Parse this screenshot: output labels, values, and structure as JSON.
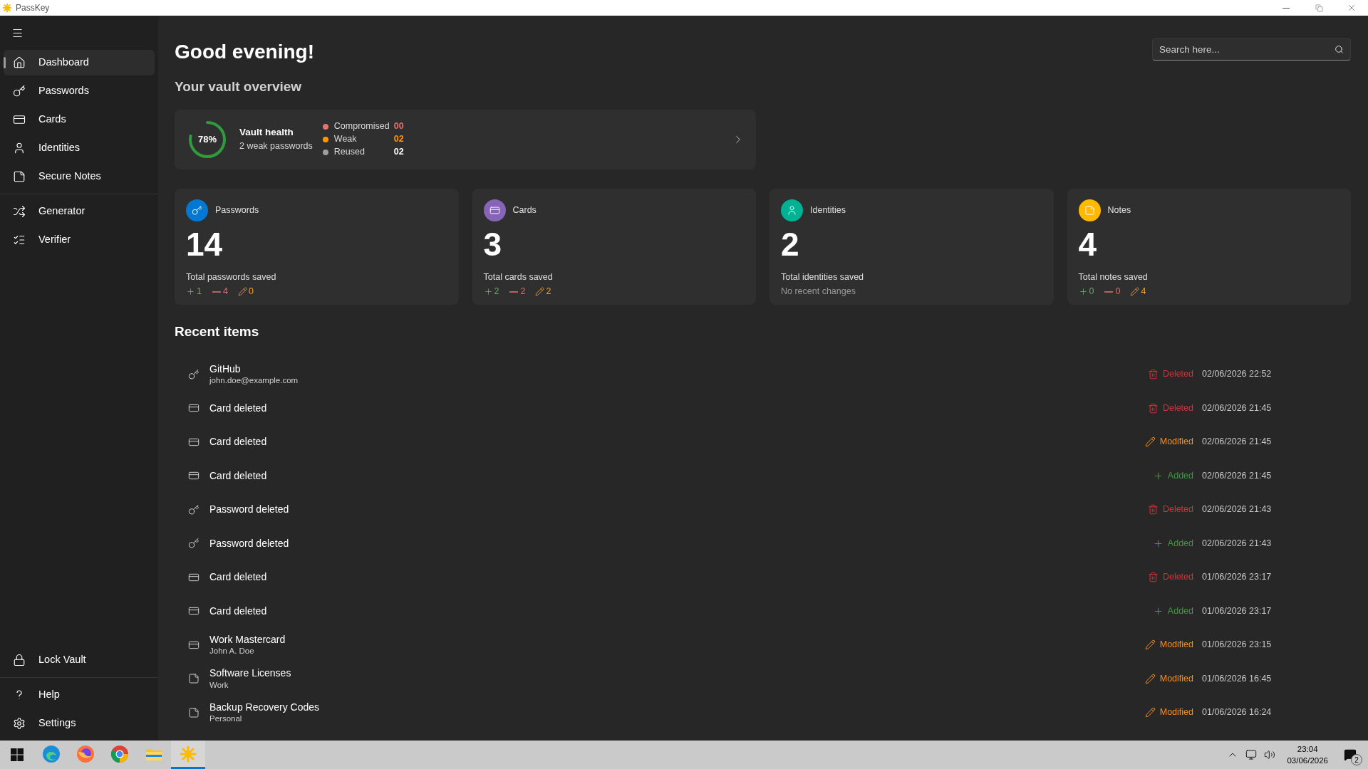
{
  "window": {
    "title": "PassKey"
  },
  "sidebar": {
    "items": [
      {
        "kind": "home",
        "label": "Dashboard",
        "selected": true
      },
      {
        "kind": "key",
        "label": "Passwords",
        "selected": false
      },
      {
        "kind": "card",
        "label": "Cards",
        "selected": false
      },
      {
        "kind": "user",
        "label": "Identities",
        "selected": false
      },
      {
        "kind": "note",
        "label": "Secure Notes",
        "selected": false
      },
      {
        "kind": "shuffle",
        "label": "Generator",
        "selected": false
      },
      {
        "kind": "list",
        "label": "Verifier",
        "selected": false
      }
    ],
    "footer_items": [
      {
        "kind": "lock",
        "label": "Lock Vault"
      },
      {
        "kind": "help",
        "label": "Help"
      },
      {
        "kind": "settings",
        "label": "Settings"
      }
    ]
  },
  "greeting": "Good evening!",
  "search": {
    "placeholder": "Search here..."
  },
  "overview_title": "Your vault overview",
  "vault_health": {
    "percent": "78%",
    "title": "Vault health",
    "subtitle": "2 weak passwords",
    "legend": [
      {
        "kind": "compromised",
        "label": "Compromised",
        "value": "00",
        "color": "#e57373"
      },
      {
        "kind": "weak",
        "label": "Weak",
        "value": "02",
        "color": "#ff9800"
      },
      {
        "kind": "reused",
        "label": "Reused",
        "value": "02",
        "color": "#9e9e9e"
      }
    ]
  },
  "stats": [
    {
      "kind": "key",
      "title": "Passwords",
      "color": "#0078d4",
      "count": "14",
      "caption": "Total passwords saved",
      "changes": [
        {
          "kind": "added",
          "value": "1"
        },
        {
          "kind": "removed",
          "value": "4"
        },
        {
          "kind": "modified",
          "value": "0"
        }
      ]
    },
    {
      "kind": "card",
      "title": "Cards",
      "color": "#8764b8",
      "count": "3",
      "caption": "Total cards saved",
      "changes": [
        {
          "kind": "added",
          "value": "2"
        },
        {
          "kind": "removed",
          "value": "2"
        },
        {
          "kind": "modified",
          "value": "2"
        }
      ]
    },
    {
      "kind": "user",
      "title": "Identities",
      "color": "#00b294",
      "count": "2",
      "caption": "Total identities saved",
      "note": "No recent changes"
    },
    {
      "kind": "note",
      "title": "Notes",
      "color": "#ffb900",
      "count": "4",
      "caption": "Total notes saved",
      "changes": [
        {
          "kind": "added",
          "value": "0"
        },
        {
          "kind": "removed",
          "value": "0"
        },
        {
          "kind": "modified",
          "value": "4"
        }
      ]
    }
  ],
  "recent_title": "Recent items",
  "recent_items": [
    {
      "kind": "key",
      "title": "GitHub",
      "subtitle": "john.doe@example.com",
      "status": {
        "kind": "deleted",
        "label": "Deleted"
      },
      "time": "02/06/2026 22:52"
    },
    {
      "kind": "card",
      "title": "Card deleted",
      "status": {
        "kind": "deleted",
        "label": "Deleted"
      },
      "time": "02/06/2026 21:45"
    },
    {
      "kind": "card",
      "title": "Card deleted",
      "status": {
        "kind": "modified",
        "label": "Modified"
      },
      "time": "02/06/2026 21:45"
    },
    {
      "kind": "card",
      "title": "Card deleted",
      "status": {
        "kind": "added",
        "label": "Added"
      },
      "time": "02/06/2026 21:45"
    },
    {
      "kind": "key",
      "title": "Password deleted",
      "status": {
        "kind": "deleted",
        "label": "Deleted"
      },
      "time": "02/06/2026 21:43"
    },
    {
      "kind": "key",
      "title": "Password deleted",
      "status": {
        "kind": "added",
        "label": "Added"
      },
      "time": "02/06/2026 21:43"
    },
    {
      "kind": "card",
      "title": "Card deleted",
      "status": {
        "kind": "deleted",
        "label": "Deleted"
      },
      "time": "01/06/2026 23:17"
    },
    {
      "kind": "card",
      "title": "Card deleted",
      "status": {
        "kind": "added",
        "label": "Added"
      },
      "time": "01/06/2026 23:17"
    },
    {
      "kind": "card",
      "title": "Work Mastercard",
      "subtitle": "John A. Doe",
      "status": {
        "kind": "modified",
        "label": "Modified"
      },
      "time": "01/06/2026 23:15"
    },
    {
      "kind": "note",
      "title": "Software Licenses",
      "subtitle": "Work",
      "status": {
        "kind": "modified",
        "label": "Modified"
      },
      "time": "01/06/2026 16:45"
    },
    {
      "kind": "note",
      "title": "Backup Recovery Codes",
      "subtitle": "Personal",
      "status": {
        "kind": "modified",
        "label": "Modified"
      },
      "time": "01/06/2026 16:24"
    }
  ],
  "taskbar": {
    "apps": [
      {
        "kind": "edge",
        "selected": false
      },
      {
        "kind": "firefox",
        "selected": false
      },
      {
        "kind": "chrome",
        "selected": false
      },
      {
        "kind": "explorer",
        "selected": false
      },
      {
        "kind": "passkey",
        "selected": true
      }
    ],
    "time": "23:04",
    "date": "03/06/2026",
    "notification_count": "2"
  }
}
